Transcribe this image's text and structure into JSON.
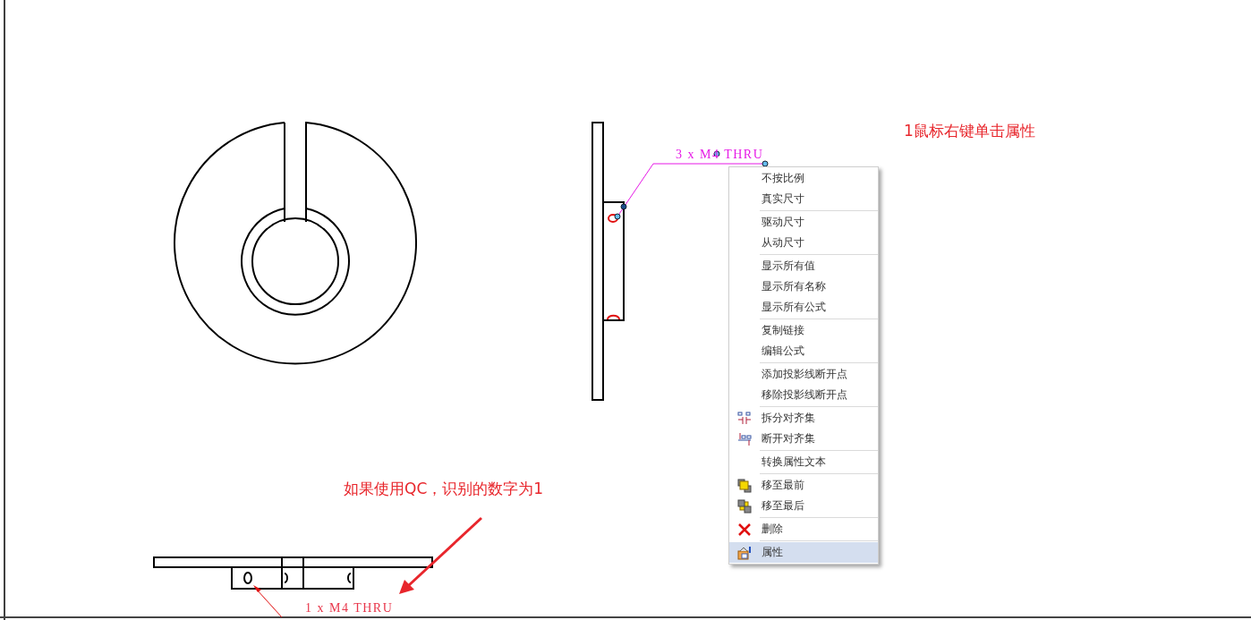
{
  "annotations": [
    {
      "text": "1鼠标右键单击属性"
    },
    {
      "text": "如果使用QC，识别的数字为1"
    }
  ],
  "callouts": [
    {
      "text": "3 x M4 THRU",
      "selected": true
    },
    {
      "text": "1 x M4 THRU",
      "selected": false
    }
  ],
  "context_menu": {
    "groups": [
      {
        "items": [
          {
            "label": "不按比例",
            "kind": "plain",
            "selected": false
          },
          {
            "label": "真实尺寸",
            "kind": "plain",
            "selected": false
          }
        ]
      },
      {
        "items": [
          {
            "label": "驱动尺寸",
            "kind": "plain",
            "selected": false
          },
          {
            "label": "从动尺寸",
            "kind": "plain",
            "selected": false
          }
        ]
      },
      {
        "items": [
          {
            "label": "显示所有值",
            "kind": "plain",
            "selected": false
          },
          {
            "label": "显示所有名称",
            "kind": "plain",
            "selected": false
          },
          {
            "label": "显示所有公式",
            "kind": "plain",
            "selected": false
          }
        ]
      },
      {
        "items": [
          {
            "label": "复制链接",
            "kind": "plain",
            "selected": false
          },
          {
            "label": "编辑公式",
            "kind": "plain",
            "selected": false
          }
        ]
      },
      {
        "items": [
          {
            "label": "添加投影线断开点",
            "kind": "plain",
            "selected": false
          },
          {
            "label": "移除投影线断开点",
            "kind": "plain",
            "selected": false
          }
        ]
      },
      {
        "items": [
          {
            "label": "拆分对齐集",
            "kind": "split",
            "selected": false
          },
          {
            "label": "断开对齐集",
            "kind": "break",
            "selected": false
          }
        ]
      },
      {
        "items": [
          {
            "label": "转换属性文本",
            "kind": "plain",
            "selected": false
          }
        ]
      },
      {
        "items": [
          {
            "label": "移至最前",
            "kind": "front",
            "selected": false
          },
          {
            "label": "移至最后",
            "kind": "back",
            "selected": false
          }
        ]
      },
      {
        "items": [
          {
            "label": "删除",
            "kind": "delete",
            "selected": false
          }
        ]
      },
      {
        "items": [
          {
            "label": "属性",
            "kind": "properties",
            "selected": true
          }
        ]
      }
    ]
  }
}
